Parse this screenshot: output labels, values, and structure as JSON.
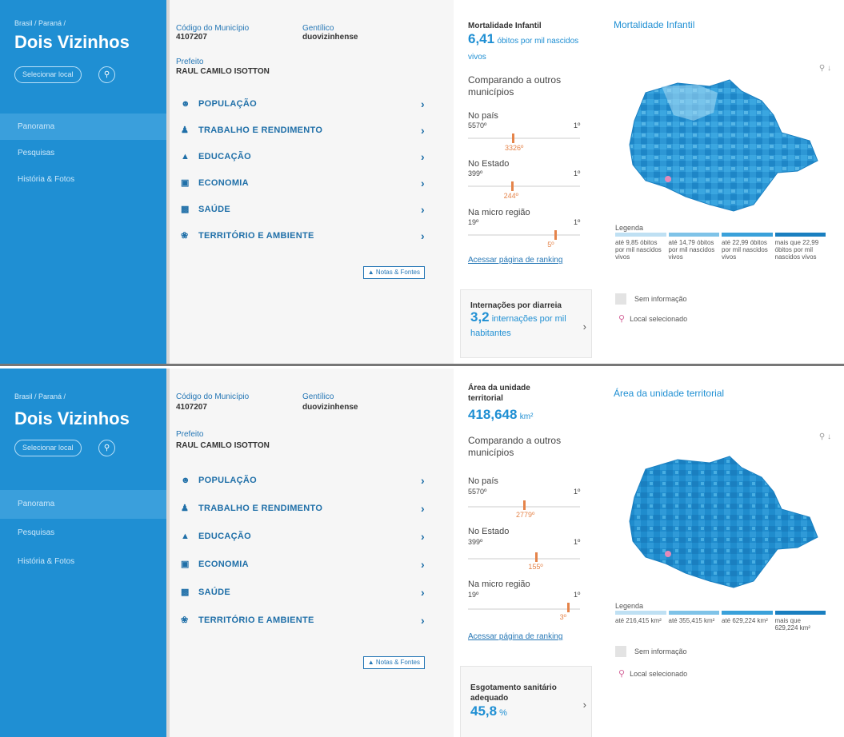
{
  "panels": [
    {
      "sidebar": {
        "breadcrumb": "Brasil / Paraná /",
        "city": "Dois Vizinhos",
        "select_label": "Selecionar local",
        "menu": [
          "Panorama",
          "Pesquisas",
          "História & Fotos"
        ]
      },
      "info": {
        "codigo_label": "Código do Município",
        "codigo_value": "4107207",
        "gentilico_label": "Gentílico",
        "gentilico_value": "duovizinhense",
        "prefeito_label": "Prefeito",
        "prefeito_value": "RAUL CAMILO ISOTTON",
        "topics": [
          {
            "label": "POPULAÇÃO",
            "icon": "people-icon"
          },
          {
            "label": "TRABALHO E RENDIMENTO",
            "icon": "worker-icon"
          },
          {
            "label": "EDUCAÇÃO",
            "icon": "graduation-cap-icon"
          },
          {
            "label": "ECONOMIA",
            "icon": "money-icon"
          },
          {
            "label": "SAÚDE",
            "icon": "health-kit-icon"
          },
          {
            "label": "TERRITÓRIO E AMBIENTE",
            "icon": "leaf-icon"
          }
        ],
        "notes_label": "Notas & Fontes"
      },
      "stats": {
        "indicator_title": "Mortalidade Infantil",
        "indicator_value": "6,41",
        "indicator_unit": "óbitos por mil nascidos vivos",
        "compare_label": "Comparando a outros municípios",
        "ranks": [
          {
            "label": "No país",
            "min": "5570º",
            "max": "1º",
            "value": "3326º",
            "fraction": 0.4
          },
          {
            "label": "No Estado",
            "min": "399º",
            "max": "1º",
            "value": "244º",
            "fraction": 0.39
          },
          {
            "label": "Na micro região",
            "min": "19º",
            "max": "1º",
            "value": "5º",
            "fraction": 0.78
          }
        ],
        "ranking_link": "Acessar página de ranking",
        "next_title": "Internações por diarreia",
        "next_value": "3,2",
        "next_unit": "internações por mil habitantes"
      },
      "map": {
        "title": "Mortalidade Infantil",
        "legend_title": "Legenda",
        "legend": [
          {
            "label": "até 9,85 óbitos por mil nascidos vivos",
            "color": "#bfe0f3"
          },
          {
            "label": "até 14,79 óbitos por mil nascidos vivos",
            "color": "#7fc3e8"
          },
          {
            "label": "até 22,99 óbitos por mil nascidos vivos",
            "color": "#3aa1da"
          },
          {
            "label": "mais que 22,99 óbitos por mil nascidos vivos",
            "color": "#1a7fc0"
          }
        ],
        "no_info": "Sem informação",
        "selected_label": "Local selecionado"
      }
    },
    {
      "sidebar": {
        "breadcrumb": "Brasil / Paraná /",
        "city": "Dois Vizinhos",
        "select_label": "Selecionar local",
        "menu": [
          "Panorama",
          "Pesquisas",
          "História & Fotos"
        ]
      },
      "info": {
        "codigo_label": "Código do Município",
        "codigo_value": "4107207",
        "gentilico_label": "Gentílico",
        "gentilico_value": "duovizinhense",
        "prefeito_label": "Prefeito",
        "prefeito_value": "RAUL CAMILO ISOTTON",
        "topics": [
          {
            "label": "POPULAÇÃO",
            "icon": "people-icon"
          },
          {
            "label": "TRABALHO E RENDIMENTO",
            "icon": "worker-icon"
          },
          {
            "label": "EDUCAÇÃO",
            "icon": "graduation-cap-icon"
          },
          {
            "label": "ECONOMIA",
            "icon": "money-icon"
          },
          {
            "label": "SAÚDE",
            "icon": "health-kit-icon"
          },
          {
            "label": "TERRITÓRIO E AMBIENTE",
            "icon": "leaf-icon"
          }
        ],
        "notes_label": "Notas & Fontes"
      },
      "stats": {
        "indicator_title": "Área da unidade territorial",
        "indicator_value": "418,648",
        "indicator_unit": "km²",
        "compare_label": "Comparando a outros municípios",
        "ranks": [
          {
            "label": "No país",
            "min": "5570º",
            "max": "1º",
            "value": "2779º",
            "fraction": 0.5
          },
          {
            "label": "No Estado",
            "min": "399º",
            "max": "1º",
            "value": "155º",
            "fraction": 0.61
          },
          {
            "label": "Na micro região",
            "min": "19º",
            "max": "1º",
            "value": "3º",
            "fraction": 0.89
          }
        ],
        "ranking_link": "Acessar página de ranking",
        "next_title": "Esgotamento sanitário adequado",
        "next_value": "45,8",
        "next_unit": "%"
      },
      "map": {
        "title": "Área da unidade territorial",
        "legend_title": "Legenda",
        "legend": [
          {
            "label": "até 216,415 km²",
            "color": "#bfe0f3"
          },
          {
            "label": "até 355,415 km²",
            "color": "#7fc3e8"
          },
          {
            "label": "até 629,224 km²",
            "color": "#3aa1da"
          },
          {
            "label": "mais que 629,224 km²",
            "color": "#1a7fc0"
          }
        ],
        "no_info": "Sem informação",
        "selected_label": "Local selecionado"
      }
    }
  ]
}
